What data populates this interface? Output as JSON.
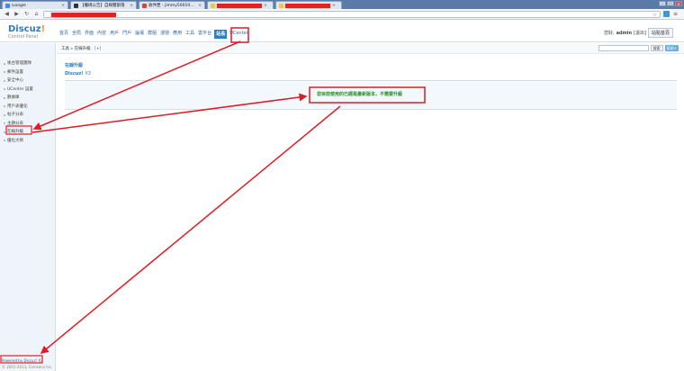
{
  "browser": {
    "tabs": [
      {
        "title": "Google",
        "redacted": false
      },
      {
        "title": "【攜碼公告】自媒體部落",
        "redacted": false
      },
      {
        "title": "收件匣 - jimmy5001003 ...",
        "redacted": false
      },
      {
        "title": "",
        "redacted": true
      },
      {
        "title": "",
        "redacted": true
      }
    ],
    "close_glyph": "×"
  },
  "header": {
    "logo_main": "Discuz",
    "logo_bang": "!",
    "logo_sub": "Control Panel",
    "nav": [
      "首頁",
      "全局",
      "界面",
      "內容",
      "用戶",
      "門戶",
      "論壇",
      "群組",
      "運營",
      "應用",
      "工具",
      "站長",
      "雲平台"
    ],
    "nav_active": "站長",
    "nav_ucenter": "UCenter",
    "user_prefix": "您好,",
    "user_name": "admin",
    "logout": "[退出]",
    "site_home": "站點首頁"
  },
  "sidebar": {
    "items": [
      "後台管理團隊",
      "郵件設置",
      "安全中心",
      "UCenter 設置",
      "數據庫",
      "用戶表優化",
      "帖子分表",
      "主題分表",
      "在線升級",
      "優化大師"
    ],
    "current": "在線升級",
    "powered": "Powered by Discuz! X3",
    "copyright": "© 2001-2013, Comsenz Inc."
  },
  "content": {
    "breadcrumb": "工具 » 在線升級",
    "breadcrumb_add": "[+]",
    "search_button": "搜索",
    "help_button": "幫助+",
    "page_title": "在線升級",
    "product": "Discuz!",
    "version": "X3",
    "message": "您目前使用的已經是最新版本，不需要升級"
  },
  "colors": {
    "annotation": "#e01b24",
    "accent": "#2f7fc3",
    "success_text": "#2a8a2a"
  }
}
